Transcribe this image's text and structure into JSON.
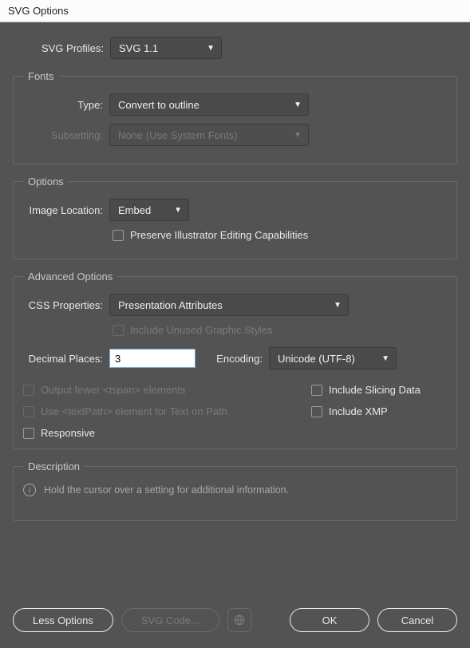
{
  "title": "SVG Options",
  "profiles": {
    "label": "SVG Profiles:",
    "value": "SVG 1.1"
  },
  "fonts": {
    "legend": "Fonts",
    "type": {
      "label": "Type:",
      "value": "Convert to outline"
    },
    "subsetting": {
      "label": "Subsetting:",
      "value": "None (Use System Fonts)"
    }
  },
  "options": {
    "legend": "Options",
    "imageLocation": {
      "label": "Image Location:",
      "value": "Embed"
    },
    "preserve": {
      "label": "Preserve Illustrator Editing Capabilities"
    }
  },
  "advanced": {
    "legend": "Advanced Options",
    "cssProps": {
      "label": "CSS Properties:",
      "value": "Presentation Attributes"
    },
    "includeUnused": {
      "label": "Include Unused Graphic Styles"
    },
    "decimal": {
      "label": "Decimal Places:",
      "value": "3"
    },
    "encoding": {
      "label": "Encoding:",
      "value": "Unicode (UTF-8)"
    },
    "outputFewer": {
      "label": "Output fewer <tspan> elements"
    },
    "useTextPath": {
      "label": "Use <textPath> element for Text on Path"
    },
    "includeSlicing": {
      "label": "Include Slicing Data"
    },
    "includeXMP": {
      "label": "Include XMP"
    },
    "responsive": {
      "label": "Responsive"
    }
  },
  "description": {
    "legend": "Description",
    "text": "Hold the cursor over a setting for additional information."
  },
  "footer": {
    "lessOptions": "Less Options",
    "svgCode": "SVG Code...",
    "ok": "OK",
    "cancel": "Cancel"
  }
}
